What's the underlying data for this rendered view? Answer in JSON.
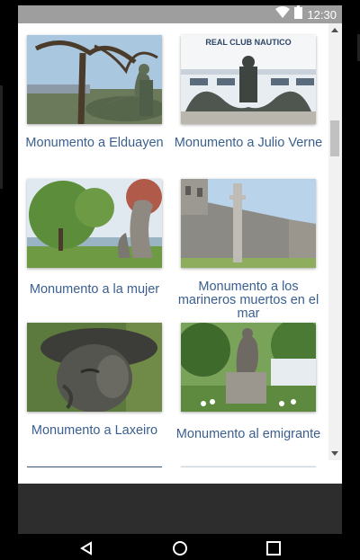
{
  "status_bar": {
    "time": "12:30",
    "icons": [
      "wifi-icon",
      "battery-icon"
    ]
  },
  "monuments": [
    {
      "title": "Monumento a Elduayen"
    },
    {
      "title": "Monumento a Julio Verne"
    },
    {
      "title": "Monumento a la mujer"
    },
    {
      "title": "Monumento a los marineros muertos en el mar"
    },
    {
      "title": "Monumento a Laxeiro"
    },
    {
      "title": "Monumento al emigrante"
    }
  ],
  "photo_signs": {
    "julio_verne": "REAL CLUB NAUTICO"
  },
  "nav_bar": {
    "buttons": [
      "back-icon",
      "home-icon",
      "recents-icon"
    ]
  },
  "colors": {
    "caption": "#3a5f8f",
    "status_bar": "#9e9e9e",
    "bottom_panel": "#2d2d2d"
  }
}
